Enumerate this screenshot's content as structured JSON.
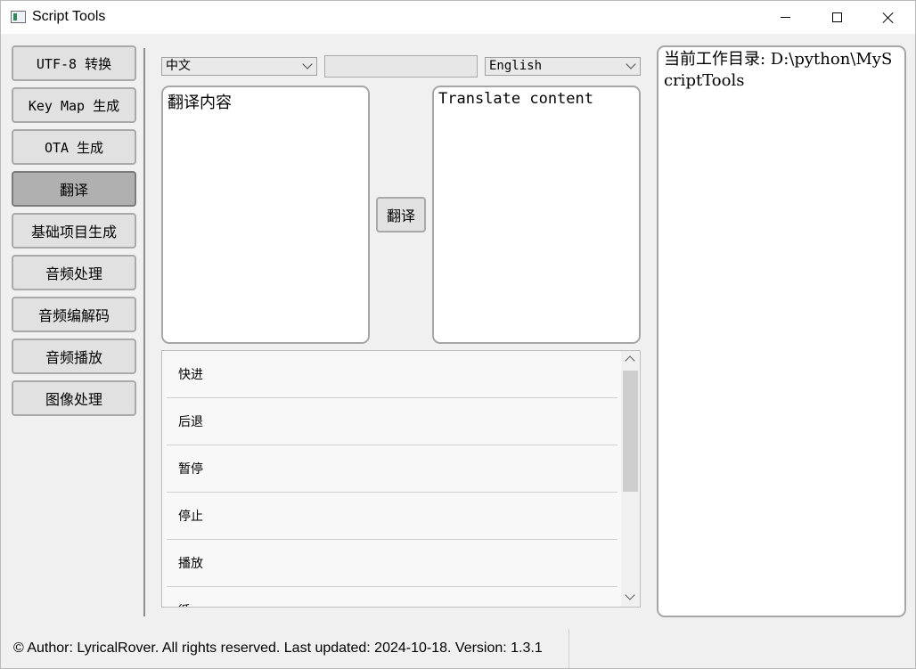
{
  "window": {
    "title": "Script Tools"
  },
  "sidebar": {
    "items": [
      {
        "label": "UTF-8 转换"
      },
      {
        "label": "Key Map 生成"
      },
      {
        "label": "OTA 生成"
      },
      {
        "label": "翻译",
        "active": true
      },
      {
        "label": "基础项目生成"
      },
      {
        "label": "音频处理"
      },
      {
        "label": "音频编解码"
      },
      {
        "label": "音频播放"
      },
      {
        "label": "图像处理"
      }
    ]
  },
  "translate": {
    "source_lang": "中文",
    "target_lang": "English",
    "middle_input_value": "",
    "source_text": "翻译内容",
    "target_text": "Translate content",
    "button_label": "翻译"
  },
  "list": {
    "items": [
      "快进",
      "后退",
      "暂停",
      "停止",
      "播放",
      "循"
    ]
  },
  "log_panel": {
    "text": "当前工作目录: D:\\python\\MyScriptTools"
  },
  "status": {
    "text": "© Author: LyricalRover. All rights reserved.  Last updated: 2024-10-18. Version: 1.3.1"
  }
}
